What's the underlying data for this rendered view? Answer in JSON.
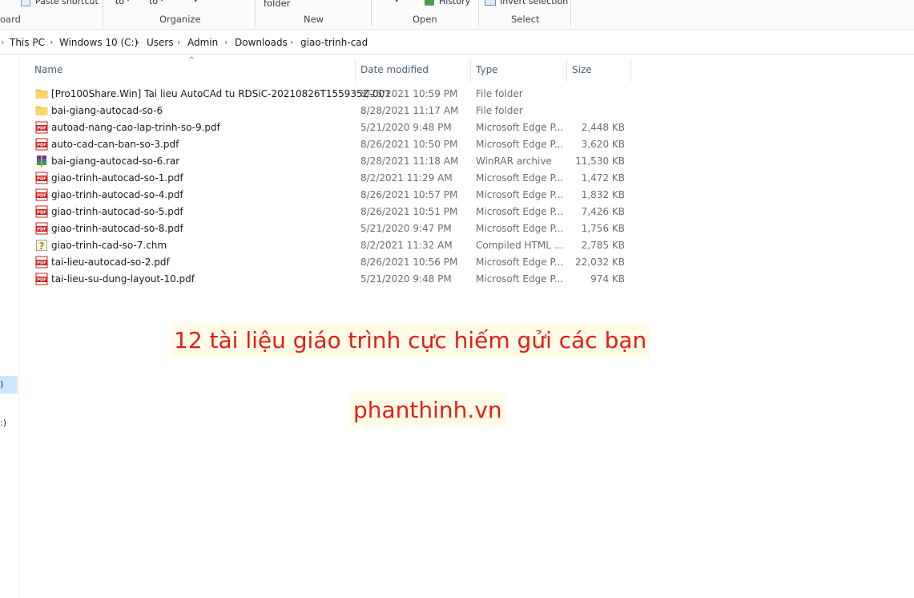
{
  "ribbon": {
    "paste_shortcut": "Paste shortcut",
    "move_to": "to",
    "copy_to": "to",
    "new_folder": "folder",
    "history": "History",
    "invert_selection": "Invert selection",
    "groups": {
      "clipboard": "oard",
      "organize": "Organize",
      "new": "New",
      "open": "Open",
      "select": "Select"
    }
  },
  "breadcrumb": [
    "This PC",
    "Windows 10 (C:)",
    "Users",
    "Admin",
    "Downloads",
    "giao-trinh-cad"
  ],
  "nav": {
    "item_a": ")",
    "item_b": ":)"
  },
  "columns": {
    "name": "Name",
    "date": "Date modified",
    "type": "Type",
    "size": "Size"
  },
  "files": [
    {
      "name": "[Pro100Share.Win] Tai lieu AutoCAd tu RDSiC-20210826T155935Z-001",
      "date": "8/26/2021 10:59 PM",
      "type": "File folder",
      "size": "",
      "icon": "folder-icon"
    },
    {
      "name": "bai-giang-autocad-so-6",
      "date": "8/28/2021 11:17 AM",
      "type": "File folder",
      "size": "",
      "icon": "folder-icon"
    },
    {
      "name": "autoad-nang-cao-lap-trinh-so-9.pdf",
      "date": "5/21/2020 9:48 PM",
      "type": "Microsoft Edge P...",
      "size": "2,448 KB",
      "icon": "pdf-icon"
    },
    {
      "name": "auto-cad-can-ban-so-3.pdf",
      "date": "8/26/2021 10:50 PM",
      "type": "Microsoft Edge P...",
      "size": "3,620 KB",
      "icon": "pdf-icon"
    },
    {
      "name": "bai-giang-autocad-so-6.rar",
      "date": "8/28/2021 11:18 AM",
      "type": "WinRAR archive",
      "size": "11,530 KB",
      "icon": "rar-icon"
    },
    {
      "name": "giao-trinh-autocad-so-1.pdf",
      "date": "8/2/2021 11:29 AM",
      "type": "Microsoft Edge P...",
      "size": "1,472 KB",
      "icon": "pdf-icon"
    },
    {
      "name": "giao-trinh-autocad-so-4.pdf",
      "date": "8/26/2021 10:57 PM",
      "type": "Microsoft Edge P...",
      "size": "1,832 KB",
      "icon": "pdf-icon"
    },
    {
      "name": "giao-trinh-autocad-so-5.pdf",
      "date": "8/26/2021 10:51 PM",
      "type": "Microsoft Edge P...",
      "size": "7,426 KB",
      "icon": "pdf-icon"
    },
    {
      "name": "giao-trinh-autocad-so-8.pdf",
      "date": "5/21/2020 9:47 PM",
      "type": "Microsoft Edge P...",
      "size": "1,756 KB",
      "icon": "pdf-icon"
    },
    {
      "name": "giao-trinh-cad-so-7.chm",
      "date": "8/2/2021 11:32 AM",
      "type": "Compiled HTML ...",
      "size": "2,785 KB",
      "icon": "chm-help-icon"
    },
    {
      "name": "tai-lieu-autocad-so-2.pdf",
      "date": "8/26/2021 10:56 PM",
      "type": "Microsoft Edge P...",
      "size": "22,032 KB",
      "icon": "pdf-icon"
    },
    {
      "name": "tai-lieu-su-dung-layout-10.pdf",
      "date": "5/21/2020 9:48 PM",
      "type": "Microsoft Edge P...",
      "size": "974 KB",
      "icon": "pdf-icon"
    }
  ],
  "overlay": {
    "line1": "12 tài liệu giáo trình cực hiếm gửi các bạn",
    "line2": "phanthinh.vn"
  },
  "colors": {
    "overlay_text": "#e0201a",
    "folder": "#f3c94d",
    "pdf": "#c8201c",
    "header_text": "#4c607a"
  }
}
